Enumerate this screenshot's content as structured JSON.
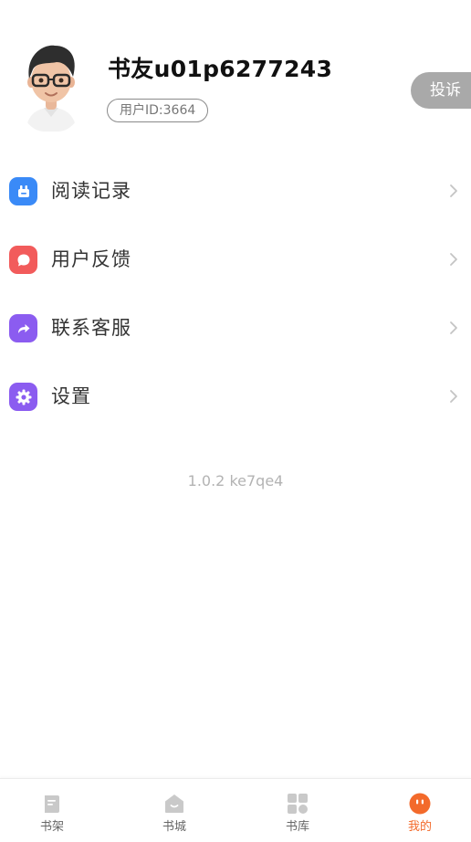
{
  "profile": {
    "username": "书友u01p6277243",
    "user_id": "用户ID:3664",
    "complain_button": "投诉"
  },
  "menu": {
    "items": [
      {
        "label": "阅读记录",
        "icon": "reading-history-icon",
        "color": "#3a8af7"
      },
      {
        "label": "用户反馈",
        "icon": "feedback-icon",
        "color": "#f25b5b"
      },
      {
        "label": "联系客服",
        "icon": "contact-service-icon",
        "color": "#8b5cf0"
      },
      {
        "label": "设置",
        "icon": "settings-icon",
        "color": "#8b5cf0"
      }
    ]
  },
  "version": "1.0.2 ke7qe4",
  "tabbar": {
    "tabs": [
      {
        "label": "书架",
        "icon": "bookshelf-icon",
        "active": false
      },
      {
        "label": "书城",
        "icon": "bookstore-icon",
        "active": false
      },
      {
        "label": "书库",
        "icon": "library-icon",
        "active": false
      },
      {
        "label": "我的",
        "icon": "me-icon",
        "active": true
      }
    ],
    "active_color": "#f36a2b",
    "inactive_color": "#666666"
  }
}
